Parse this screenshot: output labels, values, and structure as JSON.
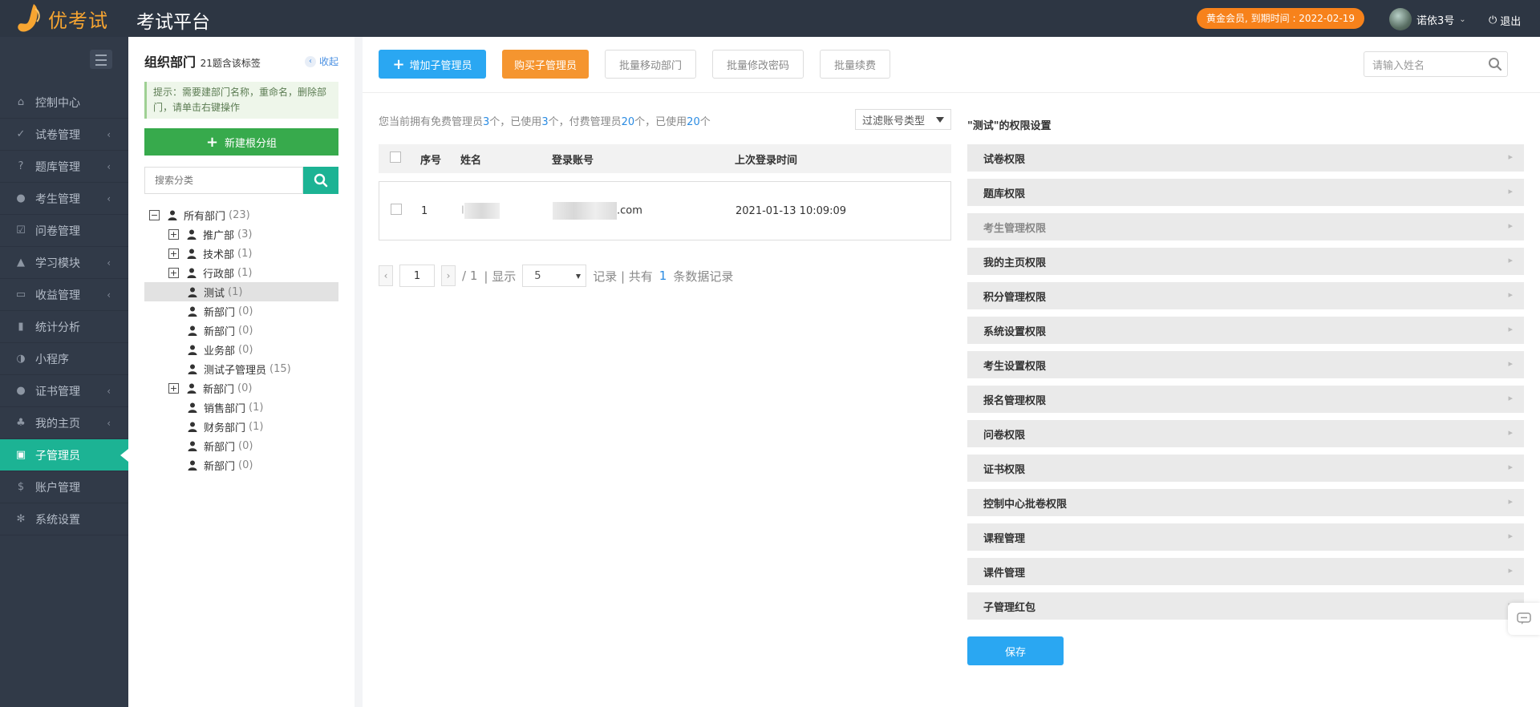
{
  "header": {
    "logo_text": "优考试",
    "app_title": "考试平台",
    "member_badge": "黄金会员, 到期时间 : 2022-02-19",
    "username": "诺依3号",
    "logout": "退出"
  },
  "sidebar": {
    "items": [
      {
        "label": "控制中心",
        "icon": "home-icon",
        "arrow": false
      },
      {
        "label": "试卷管理",
        "icon": "check-circle-icon",
        "arrow": true
      },
      {
        "label": "题库管理",
        "icon": "question-circle-icon",
        "arrow": true
      },
      {
        "label": "考生管理",
        "icon": "user-icon",
        "arrow": true
      },
      {
        "label": "问卷管理",
        "icon": "checkbox-icon",
        "arrow": false
      },
      {
        "label": "学习模块",
        "icon": "graduation-cap-icon",
        "arrow": true
      },
      {
        "label": "收益管理",
        "icon": "money-icon",
        "arrow": true
      },
      {
        "label": "统计分析",
        "icon": "bar-chart-icon",
        "arrow": false
      },
      {
        "label": "小程序",
        "icon": "wechat-icon",
        "arrow": false
      },
      {
        "label": "证书管理",
        "icon": "circle-icon",
        "arrow": true
      },
      {
        "label": "我的主页",
        "icon": "tree-icon",
        "arrow": true
      },
      {
        "label": "子管理员",
        "icon": "lock-icon",
        "arrow": false,
        "active": true
      },
      {
        "label": "账户管理",
        "icon": "dollar-icon",
        "arrow": false
      },
      {
        "label": "系统设置",
        "icon": "gear-icon",
        "arrow": false
      }
    ]
  },
  "dept": {
    "title": "组织部门",
    "subtitle": "21题含该标签",
    "collapse": "收起",
    "tip": "提示：需要建部门名称，重命名，删除部门，请单击右键操作",
    "new_group": "新建根分组",
    "search_placeholder": "搜索分类",
    "tree": [
      {
        "label": "所有部门",
        "count": "(23)",
        "level": 0,
        "expand": "−"
      },
      {
        "label": "推广部",
        "count": "(3)",
        "level": 1,
        "expand": "+"
      },
      {
        "label": "技术部",
        "count": "(1)",
        "level": 1,
        "expand": "+"
      },
      {
        "label": "行政部",
        "count": "(1)",
        "level": 1,
        "expand": "+"
      },
      {
        "label": "测试",
        "count": "(1)",
        "level": 2,
        "selected": true
      },
      {
        "label": "新部门",
        "count": "(0)",
        "level": 2
      },
      {
        "label": "新部门",
        "count": "(0)",
        "level": 2
      },
      {
        "label": "业务部",
        "count": "(0)",
        "level": 2
      },
      {
        "label": "测试子管理员",
        "count": "(15)",
        "level": 2
      },
      {
        "label": "新部门",
        "count": "(0)",
        "level": 1,
        "expand": "+"
      },
      {
        "label": "销售部门",
        "count": "(1)",
        "level": 2
      },
      {
        "label": "财务部门",
        "count": "(1)",
        "level": 2
      },
      {
        "label": "新部门",
        "count": "(0)",
        "level": 2
      },
      {
        "label": "新部门",
        "count": "(0)",
        "level": 2
      }
    ]
  },
  "toolbar": {
    "add": "增加子管理员",
    "buy": "购买子管理员",
    "move": "批量移动部门",
    "pwd": "批量修改密码",
    "renew": "批量续费",
    "search_placeholder": "请输入姓名"
  },
  "info": {
    "p1": "您当前拥有免费管理员",
    "free_total": "3",
    "p2": "个，已使用",
    "free_used": "3",
    "p3": "个，付费管理员",
    "paid_total": "20",
    "p4": "个，已使用",
    "paid_used": "20",
    "p5": "个"
  },
  "filter": "过滤账号类型",
  "table": {
    "headers": [
      "序号",
      "姓名",
      "登录账号",
      "上次登录时间"
    ],
    "rows": [
      {
        "no": "1",
        "name_prefix": "I",
        "account_suffix": ".com",
        "last_login": "2021-01-13 10:09:09"
      }
    ]
  },
  "pager": {
    "page": "1",
    "total": "/ 1",
    "show": "| 显示",
    "size": "5",
    "records": "记录 | 共有",
    "count": "1",
    "suffix": "条数据记录"
  },
  "perm": {
    "title": "\"测试\"的权限设置",
    "items": [
      "试卷权限",
      "题库权限",
      "考生管理权限",
      "我的主页权限",
      "积分管理权限",
      "系统设置权限",
      "考生设置权限",
      "报名管理权限",
      "问卷权限",
      "证书权限",
      "控制中心批卷权限",
      "课程管理",
      "课件管理",
      "子管理红包"
    ],
    "dim_index": 2,
    "save": "保存"
  },
  "colors": {
    "accent": "#1cb394",
    "primary": "#2aa7f2",
    "warning": "#f5952f",
    "sidebar": "#313a48",
    "topbar": "#2d3643"
  }
}
